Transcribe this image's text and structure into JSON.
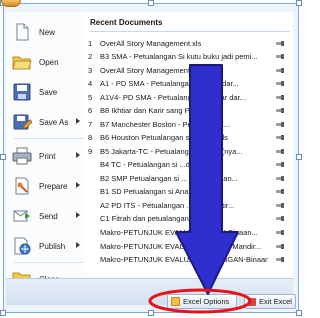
{
  "menu": {
    "items": [
      {
        "label": "New",
        "icon": "new-document-icon",
        "has_submenu": false
      },
      {
        "label": "Open",
        "icon": "open-folder-icon",
        "has_submenu": false
      },
      {
        "label": "Save",
        "icon": "save-disk-icon",
        "has_submenu": false
      },
      {
        "label": "Save As",
        "icon": "save-as-icon",
        "has_submenu": true
      },
      {
        "label": "Print",
        "icon": "print-icon",
        "has_submenu": true
      },
      {
        "label": "Prepare",
        "icon": "prepare-icon",
        "has_submenu": true
      },
      {
        "label": "Send",
        "icon": "send-icon",
        "has_submenu": true
      },
      {
        "label": "Publish",
        "icon": "publish-icon",
        "has_submenu": true
      },
      {
        "label": "Close",
        "icon": "close-folder-icon",
        "has_submenu": false
      }
    ]
  },
  "recent": {
    "title": "Recent Documents",
    "documents": [
      {
        "num": "1",
        "name": "OverAll Story Management.xls"
      },
      {
        "num": "2",
        "name": "B3 SMA - Petualangan Si kutu buku jadi pemi..."
      },
      {
        "num": "3",
        "name": "OverAll Story Management.xls"
      },
      {
        "num": "4",
        "name": "A1 - PD SMA - Petualangan ...dekar dar..."
      },
      {
        "num": "5",
        "name": "A1V4- PD SMA - Petualangan ...dekar dar..."
      },
      {
        "num": "6",
        "name": "B8 Ikhtiar dan Karir sang P..."
      },
      {
        "num": "7",
        "name": "B7 Manchester Boston - Pe...i New E..."
      },
      {
        "num": "8",
        "name": "B6 Houston Petualangan s...owboy.xls"
      },
      {
        "num": "9",
        "name": "B5 Jakarta-TC - Petualangan ...kerja(nya..."
      },
      {
        "num": "",
        "name": "B4 TC - Petualangan si ...diri.xls"
      },
      {
        "num": "",
        "name": "B2 SMP Petualangan si ... Petualangan..."
      },
      {
        "num": "",
        "name": "B1 SD Petualangan si Ana..."
      },
      {
        "num": "",
        "name": "A2 PD ITS - Petualangan ...ang Amatir..."
      },
      {
        "num": "",
        "name": "C1 Fitrah dan petualangan P..."
      },
      {
        "num": "",
        "name": "Makro-PETUNJUK EVALUASI ...GAN-Binaan..."
      },
      {
        "num": "",
        "name": "Makro-PETUNJUK EVALUASI L...GAN-Mandir..."
      },
      {
        "num": "",
        "name": "Makro-PETUNJUK EVALUASI LAPANGAN-Binaan..."
      }
    ]
  },
  "footer": {
    "excel_options": "Excel Options",
    "exit_excel": "Exit Excel"
  },
  "colors": {
    "arrow_fill": "#2f2fd0",
    "arrow_stroke": "#1a1a7a",
    "highlight_ring": "#e8101a"
  }
}
